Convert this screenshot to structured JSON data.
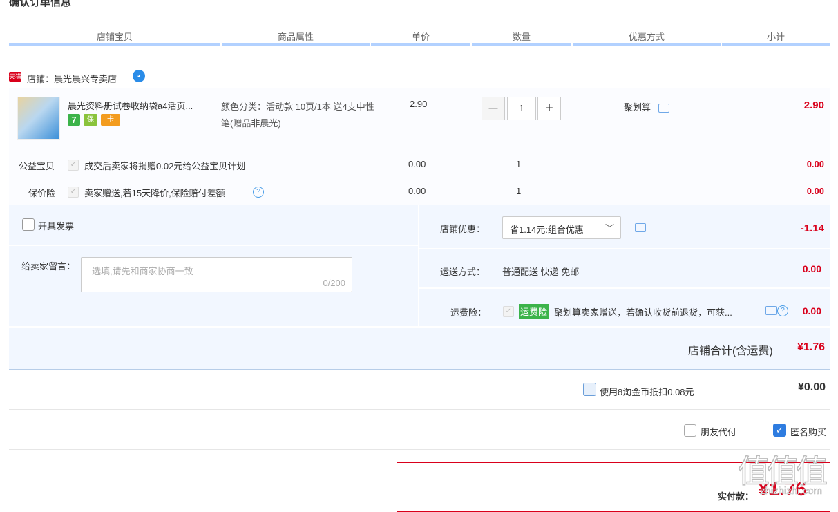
{
  "page": {
    "title": "确认订单信息"
  },
  "columns": [
    "店铺宝贝",
    "商品属性",
    "单价",
    "数量",
    "优惠方式",
    "小计"
  ],
  "shop": {
    "logo": "天猫",
    "label": "店铺：晨光晨兴专卖店",
    "wang_icon": "wangwang-icon"
  },
  "item": {
    "title": "晨光资料册试卷收纳袋a4活页...",
    "attr": "颜色分类：活动款 10页/1本 送4支中性笔(赠品非晨光)",
    "price": "2.90",
    "qty": "1",
    "qty_minus": "—",
    "qty_plus": "+",
    "promo": "聚划算",
    "subtotal": "2.90",
    "badges": [
      "7",
      "保",
      "卡"
    ]
  },
  "services": [
    {
      "label": "公益宝贝",
      "desc": "成交后卖家将捐赠0.02元给公益宝贝计划",
      "price": "0.00",
      "qty": "1",
      "subtotal": "0.00"
    },
    {
      "label": "保价险",
      "desc": "卖家赠送,若15天降价,保险赔付差额",
      "price": "0.00",
      "qty": "1",
      "subtotal": "0.00"
    }
  ],
  "invoice": {
    "label": "开具发票"
  },
  "message": {
    "label": "给卖家留言：",
    "placeholder": "选填,请先和商家协商一致",
    "counter": "0/200"
  },
  "discount": {
    "label": "店铺优惠：",
    "value": "省1.14元:组合优惠",
    "amount": "-1.14"
  },
  "shipping": {
    "label": "运送方式：",
    "value": "普通配送 快递 免邮",
    "amount": "0.00"
  },
  "freight_insurance": {
    "label": "运费险：",
    "tag": "运费险",
    "desc": "聚划算卖家赠送，若确认收货前退货，可获...",
    "amount": "0.00"
  },
  "shop_total": {
    "label": "店铺合计(含运费)",
    "amount": "¥1.76"
  },
  "coins": {
    "label": "使用8淘金币抵扣0.08元",
    "amount": "¥0.00"
  },
  "friend_pay": {
    "label": "朋友代付"
  },
  "anonymous": {
    "label": "匿名购买"
  },
  "pay": {
    "label": "实付款：",
    "amount": "¥1.76"
  },
  "watermark": {
    "text": "值值值",
    "site": "zhizhizhi.com"
  }
}
